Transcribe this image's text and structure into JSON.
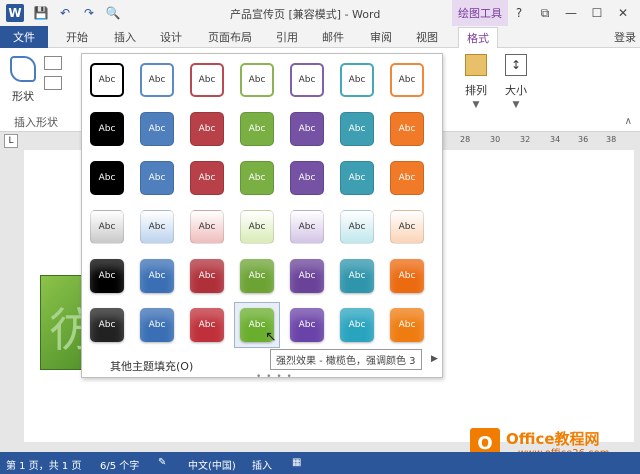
{
  "window": {
    "title": "产品宣传页 [兼容模式] - Word",
    "context_tab": "绘图工具",
    "help": "?",
    "restore": "⧉",
    "minimize": "—",
    "maximize": "☐",
    "close": "✕"
  },
  "qat": {
    "save": "💾",
    "undo": "↶",
    "redo": "↷",
    "preview": "🔍"
  },
  "tabs": {
    "file": "文件",
    "home": "开始",
    "insert": "插入",
    "design": "设计",
    "layout": "页面布局",
    "references": "引用",
    "mailings": "邮件",
    "review": "审阅",
    "view": "视图",
    "format": "格式",
    "login": "登录"
  },
  "ribbon": {
    "shape_label": "形状",
    "insert_shapes_group": "插入形状",
    "arrange_label": "排列",
    "size_label": "大小"
  },
  "ruler": {
    "marks": [
      "28",
      "30",
      "32",
      "34",
      "36",
      "38"
    ]
  },
  "gallery": {
    "swatch_text": "Abc",
    "more_fill": "其他主题填充(O)",
    "tooltip": "强烈效果 - 橄榄色，强调颜色 3",
    "rows": [
      [
        "#000000",
        "#5b8ac7",
        "#b84a52",
        "#8cb355",
        "#8060a8",
        "#45a7b8",
        "#f0873a"
      ],
      [
        "#000000",
        "#4f7fbd",
        "#b84048",
        "#7ab043",
        "#7552a3",
        "#3e9fb3",
        "#f07a28"
      ],
      [
        "#000000",
        "#4f7fbd",
        "#b84048",
        "#7ab043",
        "#7552a3",
        "#3e9fb3",
        "#f07a28"
      ],
      [
        "#c9c9c9",
        "#bcd3ee",
        "#f0bcbc",
        "#d9ecb6",
        "#d3c4e6",
        "#bfe7ed",
        "#fbd3b5"
      ],
      [
        "#000000",
        "#3a6fb5",
        "#b0303a",
        "#6da335",
        "#6a4399",
        "#2f95ab",
        "#ec6a10"
      ],
      [
        "#222222",
        "#3a6fb5",
        "#c0303a",
        "#6aae2e",
        "#6a43a8",
        "#29a4bf",
        "#ef7c10"
      ]
    ],
    "selected": {
      "row": 5,
      "col": 3
    }
  },
  "document": {
    "glyph": "彷"
  },
  "watermark": {
    "title": "Office教程网",
    "url": "www.office26.com"
  },
  "status": {
    "page": "第 1 页，共 1 页",
    "words": "6/5 个字",
    "language": "中文(中国)",
    "mode": "插入"
  }
}
